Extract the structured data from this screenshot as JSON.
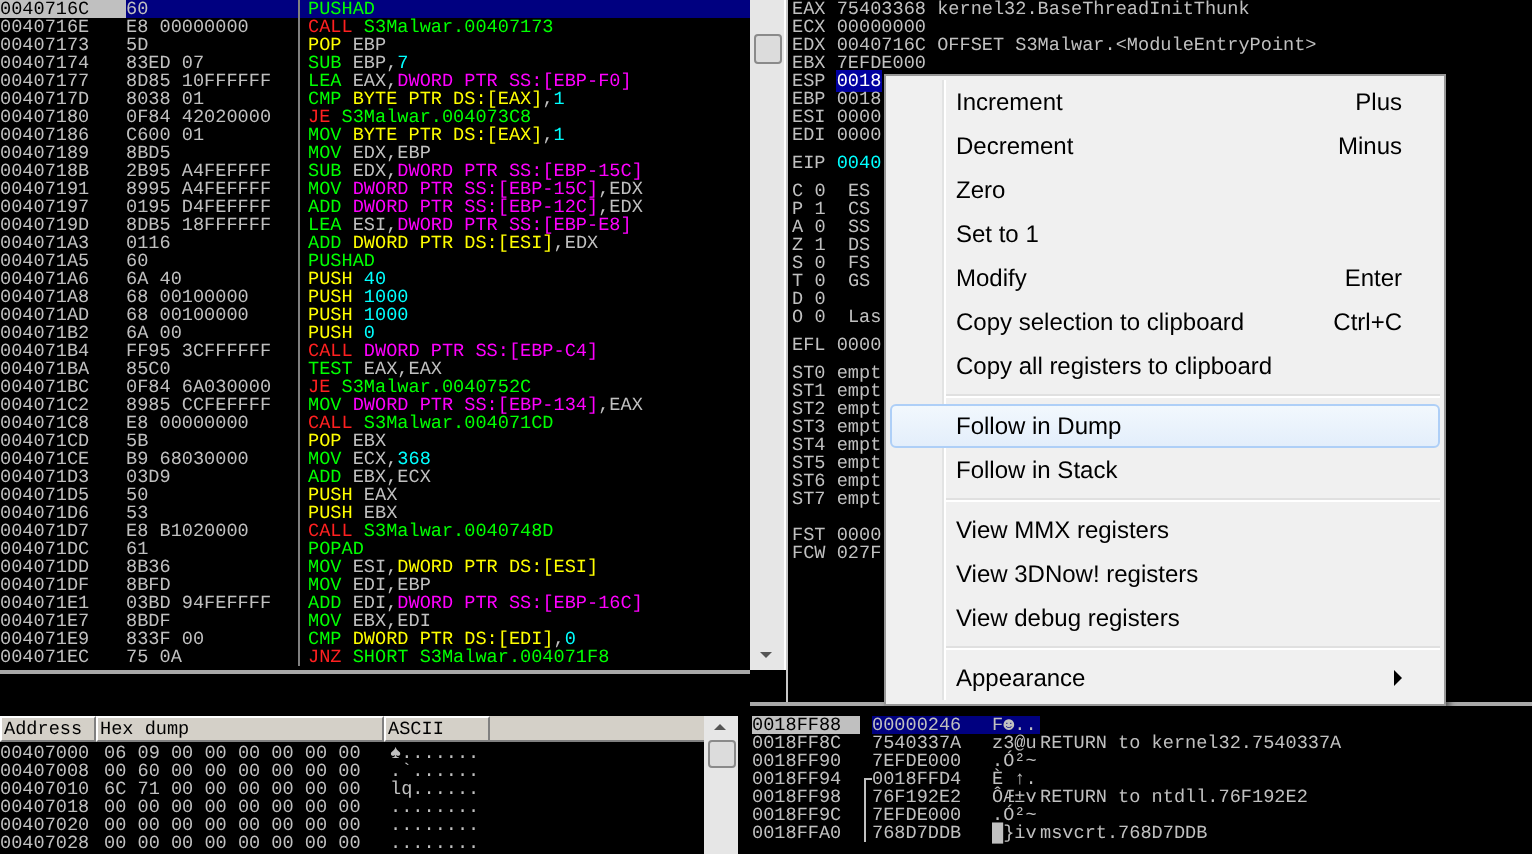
{
  "disassembly": {
    "rows": [
      {
        "address": "0040716C",
        "hex": "60",
        "selected": true,
        "mnemonic": "PUSHAD",
        "kind": "op",
        "operands": []
      },
      {
        "address": "0040716E",
        "hex": "E8 00000000",
        "selected": false,
        "mnemonic": "CALL",
        "kind": "branch",
        "operands": [
          {
            "kind": "target",
            "text": "S3Malwar.00407173"
          }
        ]
      },
      {
        "address": "00407173",
        "hex": "5D",
        "selected": false,
        "mnemonic": "POP",
        "kind": "stack",
        "operands": [
          {
            "kind": "reg",
            "text": "EBP"
          }
        ]
      },
      {
        "address": "00407174",
        "hex": "83ED 07",
        "selected": false,
        "mnemonic": "SUB",
        "kind": "op",
        "operands": [
          {
            "kind": "reg",
            "text": "EBP,"
          },
          {
            "kind": "imm",
            "text": "7"
          }
        ]
      },
      {
        "address": "00407177",
        "hex": "8D85 10FFFFFF",
        "selected": false,
        "mnemonic": "LEA",
        "kind": "op",
        "operands": [
          {
            "kind": "reg",
            "text": "EAX,"
          },
          {
            "kind": "ss",
            "text": "DWORD PTR SS:[EBP-F0]"
          }
        ]
      },
      {
        "address": "0040717D",
        "hex": "8038 01",
        "selected": false,
        "mnemonic": "CMP",
        "kind": "op",
        "operands": [
          {
            "kind": "ds",
            "text": "BYTE PTR DS:[EAX]"
          },
          {
            "kind": "reg",
            "text": ","
          },
          {
            "kind": "imm",
            "text": "1"
          }
        ]
      },
      {
        "address": "00407180",
        "hex": "0F84 42020000",
        "selected": false,
        "mnemonic": "JE",
        "kind": "branch",
        "operands": [
          {
            "kind": "target",
            "text": "S3Malwar.004073C8"
          }
        ]
      },
      {
        "address": "00407186",
        "hex": "C600 01",
        "selected": false,
        "mnemonic": "MOV",
        "kind": "op",
        "operands": [
          {
            "kind": "ds",
            "text": "BYTE PTR DS:[EAX]"
          },
          {
            "kind": "reg",
            "text": ","
          },
          {
            "kind": "imm",
            "text": "1"
          }
        ]
      },
      {
        "address": "00407189",
        "hex": "8BD5",
        "selected": false,
        "mnemonic": "MOV",
        "kind": "op",
        "operands": [
          {
            "kind": "reg",
            "text": "EDX,EBP"
          }
        ]
      },
      {
        "address": "0040718B",
        "hex": "2B95 A4FEFFFF",
        "selected": false,
        "mnemonic": "SUB",
        "kind": "op",
        "operands": [
          {
            "kind": "reg",
            "text": "EDX,"
          },
          {
            "kind": "ss",
            "text": "DWORD PTR SS:[EBP-15C]"
          }
        ]
      },
      {
        "address": "00407191",
        "hex": "8995 A4FEFFFF",
        "selected": false,
        "mnemonic": "MOV",
        "kind": "op",
        "operands": [
          {
            "kind": "ss",
            "text": "DWORD PTR SS:[EBP-15C]"
          },
          {
            "kind": "reg",
            "text": ",EDX"
          }
        ]
      },
      {
        "address": "00407197",
        "hex": "0195 D4FEFFFF",
        "selected": false,
        "mnemonic": "ADD",
        "kind": "op",
        "operands": [
          {
            "kind": "ss",
            "text": "DWORD PTR SS:[EBP-12C]"
          },
          {
            "kind": "reg",
            "text": ",EDX"
          }
        ]
      },
      {
        "address": "0040719D",
        "hex": "8DB5 18FFFFFF",
        "selected": false,
        "mnemonic": "LEA",
        "kind": "op",
        "operands": [
          {
            "kind": "reg",
            "text": "ESI,"
          },
          {
            "kind": "ss",
            "text": "DWORD PTR SS:[EBP-E8]"
          }
        ]
      },
      {
        "address": "004071A3",
        "hex": "0116",
        "selected": false,
        "mnemonic": "ADD",
        "kind": "op",
        "operands": [
          {
            "kind": "ds",
            "text": "DWORD PTR DS:[ESI]"
          },
          {
            "kind": "reg",
            "text": ",EDX"
          }
        ]
      },
      {
        "address": "004071A5",
        "hex": "60",
        "selected": false,
        "mnemonic": "PUSHAD",
        "kind": "op",
        "operands": []
      },
      {
        "address": "004071A6",
        "hex": "6A 40",
        "selected": false,
        "mnemonic": "PUSH",
        "kind": "stack",
        "operands": [
          {
            "kind": "imm",
            "text": "40"
          }
        ]
      },
      {
        "address": "004071A8",
        "hex": "68 00100000",
        "selected": false,
        "mnemonic": "PUSH",
        "kind": "stack",
        "operands": [
          {
            "kind": "imm",
            "text": "1000"
          }
        ]
      },
      {
        "address": "004071AD",
        "hex": "68 00100000",
        "selected": false,
        "mnemonic": "PUSH",
        "kind": "stack",
        "operands": [
          {
            "kind": "imm",
            "text": "1000"
          }
        ]
      },
      {
        "address": "004071B2",
        "hex": "6A 00",
        "selected": false,
        "mnemonic": "PUSH",
        "kind": "stack",
        "operands": [
          {
            "kind": "imm",
            "text": "0"
          }
        ]
      },
      {
        "address": "004071B4",
        "hex": "FF95 3CFFFFFF",
        "selected": false,
        "mnemonic": "CALL",
        "kind": "branch",
        "operands": [
          {
            "kind": "ss",
            "text": "DWORD PTR SS:[EBP-C4]"
          }
        ]
      },
      {
        "address": "004071BA",
        "hex": "85C0",
        "selected": false,
        "mnemonic": "TEST",
        "kind": "op",
        "operands": [
          {
            "kind": "reg",
            "text": "EAX,EAX"
          }
        ]
      },
      {
        "address": "004071BC",
        "hex": "0F84 6A030000",
        "selected": false,
        "mnemonic": "JE",
        "kind": "branch",
        "operands": [
          {
            "kind": "target",
            "text": "S3Malwar.0040752C"
          }
        ]
      },
      {
        "address": "004071C2",
        "hex": "8985 CCFEFFFF",
        "selected": false,
        "mnemonic": "MOV",
        "kind": "op",
        "operands": [
          {
            "kind": "ss",
            "text": "DWORD PTR SS:[EBP-134]"
          },
          {
            "kind": "reg",
            "text": ",EAX"
          }
        ]
      },
      {
        "address": "004071C8",
        "hex": "E8 00000000",
        "selected": false,
        "mnemonic": "CALL",
        "kind": "branch",
        "operands": [
          {
            "kind": "target",
            "text": "S3Malwar.004071CD"
          }
        ]
      },
      {
        "address": "004071CD",
        "hex": "5B",
        "selected": false,
        "mnemonic": "POP",
        "kind": "stack",
        "operands": [
          {
            "kind": "reg",
            "text": "EBX"
          }
        ]
      },
      {
        "address": "004071CE",
        "hex": "B9 68030000",
        "selected": false,
        "mnemonic": "MOV",
        "kind": "op",
        "operands": [
          {
            "kind": "reg",
            "text": "ECX,"
          },
          {
            "kind": "imm",
            "text": "368"
          }
        ]
      },
      {
        "address": "004071D3",
        "hex": "03D9",
        "selected": false,
        "mnemonic": "ADD",
        "kind": "op",
        "operands": [
          {
            "kind": "reg",
            "text": "EBX,ECX"
          }
        ]
      },
      {
        "address": "004071D5",
        "hex": "50",
        "selected": false,
        "mnemonic": "PUSH",
        "kind": "stack",
        "operands": [
          {
            "kind": "reg",
            "text": "EAX"
          }
        ]
      },
      {
        "address": "004071D6",
        "hex": "53",
        "selected": false,
        "mnemonic": "PUSH",
        "kind": "stack",
        "operands": [
          {
            "kind": "reg",
            "text": "EBX"
          }
        ]
      },
      {
        "address": "004071D7",
        "hex": "E8 B1020000",
        "selected": false,
        "mnemonic": "CALL",
        "kind": "branch",
        "operands": [
          {
            "kind": "target",
            "text": "S3Malwar.0040748D"
          }
        ]
      },
      {
        "address": "004071DC",
        "hex": "61",
        "selected": false,
        "mnemonic": "POPAD",
        "kind": "op",
        "operands": []
      },
      {
        "address": "004071DD",
        "hex": "8B36",
        "selected": false,
        "mnemonic": "MOV",
        "kind": "op",
        "operands": [
          {
            "kind": "reg",
            "text": "ESI,"
          },
          {
            "kind": "ds",
            "text": "DWORD PTR DS:[ESI]"
          }
        ]
      },
      {
        "address": "004071DF",
        "hex": "8BFD",
        "selected": false,
        "mnemonic": "MOV",
        "kind": "op",
        "operands": [
          {
            "kind": "reg",
            "text": "EDI,EBP"
          }
        ]
      },
      {
        "address": "004071E1",
        "hex": "03BD 94FEFFFF",
        "selected": false,
        "mnemonic": "ADD",
        "kind": "op",
        "operands": [
          {
            "kind": "reg",
            "text": "EDI,"
          },
          {
            "kind": "ss",
            "text": "DWORD PTR SS:[EBP-16C]"
          }
        ]
      },
      {
        "address": "004071E7",
        "hex": "8BDF",
        "selected": false,
        "mnemonic": "MOV",
        "kind": "op",
        "operands": [
          {
            "kind": "reg",
            "text": "EBX,EDI"
          }
        ]
      },
      {
        "address": "004071E9",
        "hex": "833F 00",
        "selected": false,
        "mnemonic": "CMP",
        "kind": "op",
        "operands": [
          {
            "kind": "ds",
            "text": "DWORD PTR DS:[EDI]"
          },
          {
            "kind": "reg",
            "text": ","
          },
          {
            "kind": "imm",
            "text": "0"
          }
        ]
      },
      {
        "address": "004071EC",
        "hex": "75 0A",
        "selected": false,
        "mnemonic": "JNZ",
        "kind": "branch",
        "operands": [
          {
            "kind": "target",
            "text": "SHORT S3Malwar.004071F8"
          }
        ]
      }
    ]
  },
  "registers": {
    "groups": [
      {
        "lines": [
          {
            "name": "EAX",
            "value": "75403368",
            "selected": false,
            "modified": false,
            "comment": "kernel32.BaseThreadInitThunk"
          },
          {
            "name": "ECX",
            "value": "00000000",
            "selected": false,
            "modified": false
          },
          {
            "name": "EDX",
            "value": "0040716C",
            "selected": false,
            "modified": false,
            "comment": "OFFSET S3Malwar.<ModuleEntryPoint>"
          },
          {
            "name": "EBX",
            "value": "7EFDE000",
            "selected": false,
            "modified": false
          },
          {
            "name": "ESP",
            "value": "0018",
            "selected": true,
            "modified": false
          },
          {
            "name": "EBP",
            "value": "0018",
            "selected": false,
            "modified": false
          },
          {
            "name": "ESI",
            "value": "0000",
            "selected": false,
            "modified": false
          },
          {
            "name": "EDI",
            "value": "0000",
            "selected": false,
            "modified": false
          }
        ]
      },
      {
        "lines": [
          {
            "name": "EIP",
            "value": "0040",
            "selected": false,
            "modified": true
          }
        ]
      },
      {
        "lines": [
          {
            "name": "C",
            "value": "0",
            "selected": false,
            "modified": false,
            "segment": "ES"
          },
          {
            "name": "P",
            "value": "1",
            "selected": false,
            "modified": false,
            "segment": "CS"
          },
          {
            "name": "A",
            "value": "0",
            "selected": false,
            "modified": false,
            "segment": "SS"
          },
          {
            "name": "Z",
            "value": "1",
            "selected": false,
            "modified": false,
            "segment": "DS"
          },
          {
            "name": "S",
            "value": "0",
            "selected": false,
            "modified": false,
            "segment": "FS"
          },
          {
            "name": "T",
            "value": "0",
            "selected": false,
            "modified": false,
            "segment": "GS"
          },
          {
            "name": "D",
            "value": "0",
            "selected": false,
            "modified": false
          },
          {
            "name": "O",
            "value": "0",
            "selected": false,
            "modified": false,
            "segment": "Las"
          }
        ]
      },
      {
        "lines": [
          {
            "name": "EFL",
            "value": "0000",
            "selected": false,
            "modified": false
          }
        ]
      },
      {
        "lines": [
          {
            "name": "ST0",
            "value": "empt",
            "selected": false,
            "modified": false
          },
          {
            "name": "ST1",
            "value": "empt",
            "selected": false,
            "modified": false
          },
          {
            "name": "ST2",
            "value": "empt",
            "selected": false,
            "modified": false
          },
          {
            "name": "ST3",
            "value": "empt",
            "selected": false,
            "modified": false
          },
          {
            "name": "ST4",
            "value": "empt",
            "selected": false,
            "modified": false
          },
          {
            "name": "ST5",
            "value": "empt",
            "selected": false,
            "modified": false
          },
          {
            "name": "ST6",
            "value": "empt",
            "selected": false,
            "modified": false
          },
          {
            "name": "ST7",
            "value": "empt",
            "selected": false,
            "modified": false
          }
        ]
      },
      {
        "lines": [
          {
            "name": "FST",
            "value": "0000",
            "selected": false,
            "modified": false
          },
          {
            "name": "FCW",
            "value": "027F",
            "selected": false,
            "modified": false
          }
        ]
      }
    ]
  },
  "context_menu": {
    "items": [
      {
        "kind": "item",
        "label": "Increment",
        "shortcut": "Plus",
        "selected": false,
        "submenu": false
      },
      {
        "kind": "item",
        "label": "Decrement",
        "shortcut": "Minus",
        "selected": false,
        "submenu": false
      },
      {
        "kind": "item",
        "label": "Zero",
        "selected": false,
        "submenu": false
      },
      {
        "kind": "item",
        "label": "Set to 1",
        "selected": false,
        "submenu": false
      },
      {
        "kind": "item",
        "label": "Modify",
        "shortcut": "Enter",
        "selected": false,
        "submenu": false
      },
      {
        "kind": "item",
        "label": "Copy selection to clipboard",
        "shortcut": "Ctrl+C",
        "selected": false,
        "submenu": false
      },
      {
        "kind": "item",
        "label": "Copy all registers to clipboard",
        "selected": false,
        "submenu": false
      },
      {
        "kind": "separator"
      },
      {
        "kind": "item",
        "label": "Follow in Dump",
        "selected": true,
        "submenu": false
      },
      {
        "kind": "item",
        "label": "Follow in Stack",
        "selected": false,
        "submenu": false
      },
      {
        "kind": "separator"
      },
      {
        "kind": "item",
        "label": "View MMX registers",
        "selected": false,
        "submenu": false
      },
      {
        "kind": "item",
        "label": "View 3DNow! registers",
        "selected": false,
        "submenu": false
      },
      {
        "kind": "item",
        "label": "View debug registers",
        "selected": false,
        "submenu": false
      },
      {
        "kind": "separator"
      },
      {
        "kind": "item",
        "label": "Appearance",
        "selected": false,
        "submenu": true
      }
    ]
  },
  "dump": {
    "columns": [
      "Address",
      "Hex dump",
      "ASCII"
    ],
    "rows": [
      {
        "address": "00407000",
        "hex": "06 09 00 00 00 00 00 00",
        "ascii": "♠......."
      },
      {
        "address": "00407008",
        "hex": "00 60 00 00 00 00 00 00",
        "ascii": ".`......"
      },
      {
        "address": "00407010",
        "hex": "6C 71 00 00 00 00 00 00",
        "ascii": "lq......"
      },
      {
        "address": "00407018",
        "hex": "00 00 00 00 00 00 00 00",
        "ascii": "........"
      },
      {
        "address": "00407020",
        "hex": "00 00 00 00 00 00 00 00",
        "ascii": "........"
      },
      {
        "address": "00407028",
        "hex": "00 00 00 00 00 00 00 00",
        "ascii": "........"
      }
    ]
  },
  "stack": {
    "rows": [
      {
        "address": "0018FF88",
        "value": "00000246",
        "ascii": "F☻..",
        "selected": true,
        "frame_start": false,
        "in_frame": false
      },
      {
        "address": "0018FF8C",
        "value": "7540337A",
        "ascii": "z3@u",
        "comment": "RETURN to kernel32.7540337A",
        "selected": false,
        "frame_start": false,
        "in_frame": false
      },
      {
        "address": "0018FF90",
        "value": "7EFDE000",
        "ascii": ".Ó²~",
        "selected": false,
        "frame_start": false,
        "in_frame": false
      },
      {
        "address": "0018FF94",
        "value": "0018FFD4",
        "ascii": "È ↑.",
        "selected": false,
        "frame_start": true,
        "in_frame": false
      },
      {
        "address": "0018FF98",
        "value": "76F192E2",
        "ascii": "ÔÆ±v",
        "comment": "RETURN to ntdll.76F192E2",
        "selected": false,
        "frame_start": false,
        "in_frame": true
      },
      {
        "address": "0018FF9C",
        "value": "7EFDE000",
        "ascii": ".Ó²~",
        "selected": false,
        "frame_start": false,
        "in_frame": true
      },
      {
        "address": "0018FFA0",
        "value": "768D7DDB",
        "ascii": "█}iv",
        "comment": "msvcrt.768D7DDB",
        "selected": false,
        "frame_start": false,
        "in_frame": true
      }
    ]
  }
}
